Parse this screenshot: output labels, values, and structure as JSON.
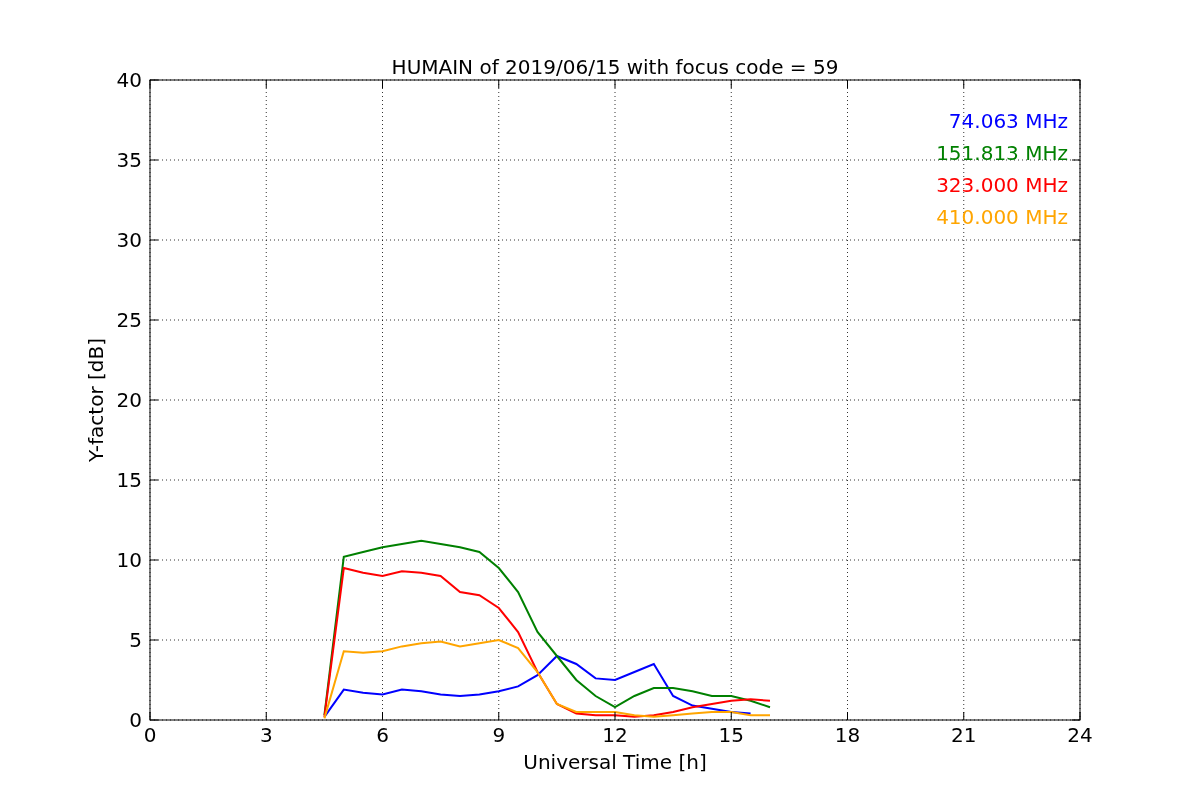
{
  "figure": {
    "chart_data": {
      "type": "line",
      "title": "HUMAIN of 2019/06/15 with focus code = 59",
      "xlabel": "Universal Time [h]",
      "ylabel": "Y-factor [dB]",
      "x": [
        4.5,
        5,
        5.5,
        6,
        6.5,
        7,
        7.5,
        8,
        8.5,
        9,
        9.5,
        10,
        10.5,
        11,
        11.5,
        12,
        12.5,
        13,
        13.5,
        14,
        14.5,
        15,
        15.5,
        16
      ],
      "series": [
        {
          "name": "74.063 MHz",
          "color": "#0000ff",
          "values": [
            0.2,
            1.9,
            1.7,
            1.6,
            1.9,
            1.8,
            1.6,
            1.5,
            1.6,
            1.8,
            2.1,
            2.8,
            4,
            3.5,
            2.6,
            2.5,
            3,
            3.5,
            1.5,
            0.9,
            0.7,
            0.5,
            0.4,
            null
          ]
        },
        {
          "name": "151.813 MHz",
          "color": "#008000",
          "values": [
            0.3,
            10.2,
            10.5,
            10.8,
            11,
            11.2,
            11,
            10.8,
            10.5,
            9.5,
            8,
            5.5,
            4,
            2.5,
            1.5,
            0.8,
            1.5,
            2,
            2,
            1.8,
            1.5,
            1.5,
            1.2,
            0.8
          ]
        },
        {
          "name": "323.000 MHz",
          "color": "#ff0000",
          "values": [
            0.2,
            9.5,
            9.2,
            9,
            9.3,
            9.2,
            9,
            8,
            7.8,
            7,
            5.5,
            3,
            1,
            0.4,
            0.3,
            0.3,
            0.2,
            0.3,
            0.5,
            0.8,
            1,
            1.2,
            1.3,
            1.2
          ]
        },
        {
          "name": "410.000 MHz",
          "color": "#ffa500",
          "values": [
            0.1,
            4.3,
            4.2,
            4.3,
            4.6,
            4.8,
            4.9,
            4.6,
            4.8,
            5,
            4.5,
            3,
            1,
            0.5,
            0.5,
            0.5,
            0.3,
            0.2,
            0.3,
            0.4,
            0.5,
            0.5,
            0.3,
            0.3
          ]
        }
      ],
      "grid": true,
      "xlim": [
        0,
        24
      ],
      "ylim": [
        0,
        40
      ],
      "xticks": [
        0,
        3,
        6,
        9,
        12,
        15,
        18,
        21,
        24
      ],
      "yticks": [
        0,
        5,
        10,
        15,
        20,
        25,
        30,
        35,
        40
      ]
    }
  }
}
